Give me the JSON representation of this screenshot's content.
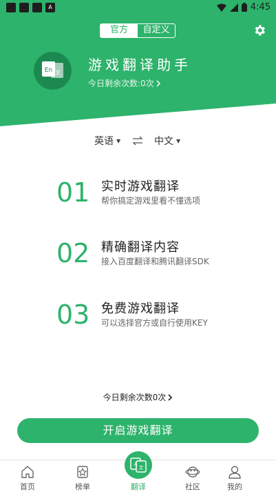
{
  "status": {
    "left_badge": "A",
    "time": "4:45"
  },
  "header": {
    "tabs": [
      {
        "label": "官方",
        "active": true
      },
      {
        "label": "自定义",
        "active": false
      }
    ],
    "title": "游戏翻译助手",
    "remaining": "今日剩余次数:0次",
    "logo": {
      "left_text": "En",
      "right_text": "文"
    }
  },
  "languages": {
    "source": "英语",
    "target": "中文"
  },
  "features": [
    {
      "num": "01",
      "title": "实时游戏翻译",
      "subtitle": "帮你搞定游戏里看不懂选项"
    },
    {
      "num": "02",
      "title": "精确翻译内容",
      "subtitle": "接入百度翻译和腾讯翻译SDK"
    },
    {
      "num": "03",
      "title": "免费游戏翻译",
      "subtitle": "可以选择官方或自行使用KEY"
    }
  ],
  "remaining_bottom": "今日剩余次数0次",
  "start_button": "开启游戏翻译",
  "tabbar": [
    {
      "label": "首页",
      "icon": "home-icon"
    },
    {
      "label": "榜单",
      "icon": "ranking-icon"
    },
    {
      "label": "翻译",
      "icon": "translate-icon",
      "active": true
    },
    {
      "label": "社区",
      "icon": "community-icon"
    },
    {
      "label": "我的",
      "icon": "profile-icon"
    }
  ],
  "colors": {
    "primary": "#2db36b",
    "primary_dark": "#1c8a50"
  }
}
